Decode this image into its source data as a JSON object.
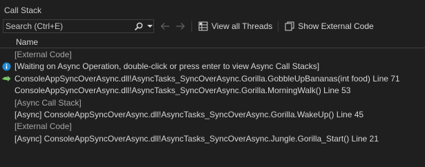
{
  "window": {
    "title": "Call Stack"
  },
  "toolbar": {
    "search_placeholder": "Search (Ctrl+E)",
    "view_all_threads": "View all Threads",
    "show_external_code": "Show External Code"
  },
  "table": {
    "column_name": "Name"
  },
  "rows": [
    {
      "text": "[External Code]",
      "style": "grey",
      "icon": ""
    },
    {
      "text": "[Waiting on Async Operation, double-click or press enter to view Async Call Stacks]",
      "style": "normal",
      "icon": "info-icon"
    },
    {
      "text": "ConsoleAppSyncOverAsync.dll!AsyncTasks_SyncOverAsync.Gorilla.GobbleUpBananas(int food) Line 71",
      "style": "normal",
      "icon": "current-frame-arrow-icon"
    },
    {
      "text": "ConsoleAppSyncOverAsync.dll!AsyncTasks_SyncOverAsync.Gorilla.MorningWalk() Line 53",
      "style": "normal",
      "icon": ""
    },
    {
      "text": "[Async Call Stack]",
      "style": "grey",
      "icon": ""
    },
    {
      "text": "[Async] ConsoleAppSyncOverAsync.dll!AsyncTasks_SyncOverAsync.Gorilla.WakeUp() Line 45",
      "style": "normal",
      "icon": ""
    },
    {
      "text": "[External Code]",
      "style": "grey",
      "icon": ""
    },
    {
      "text": "[Async] ConsoleAppSyncOverAsync.dll!AsyncTasks_SyncOverAsync.Jungle.Gorilla_Start() Line 21",
      "style": "normal",
      "icon": ""
    }
  ],
  "colors": {
    "background": "#1f1f1f",
    "text": "#d6d6d6",
    "grey_text": "#a6a6a6",
    "info_blue": "#1e8ad6",
    "arrow_green": "#7cc36a"
  }
}
